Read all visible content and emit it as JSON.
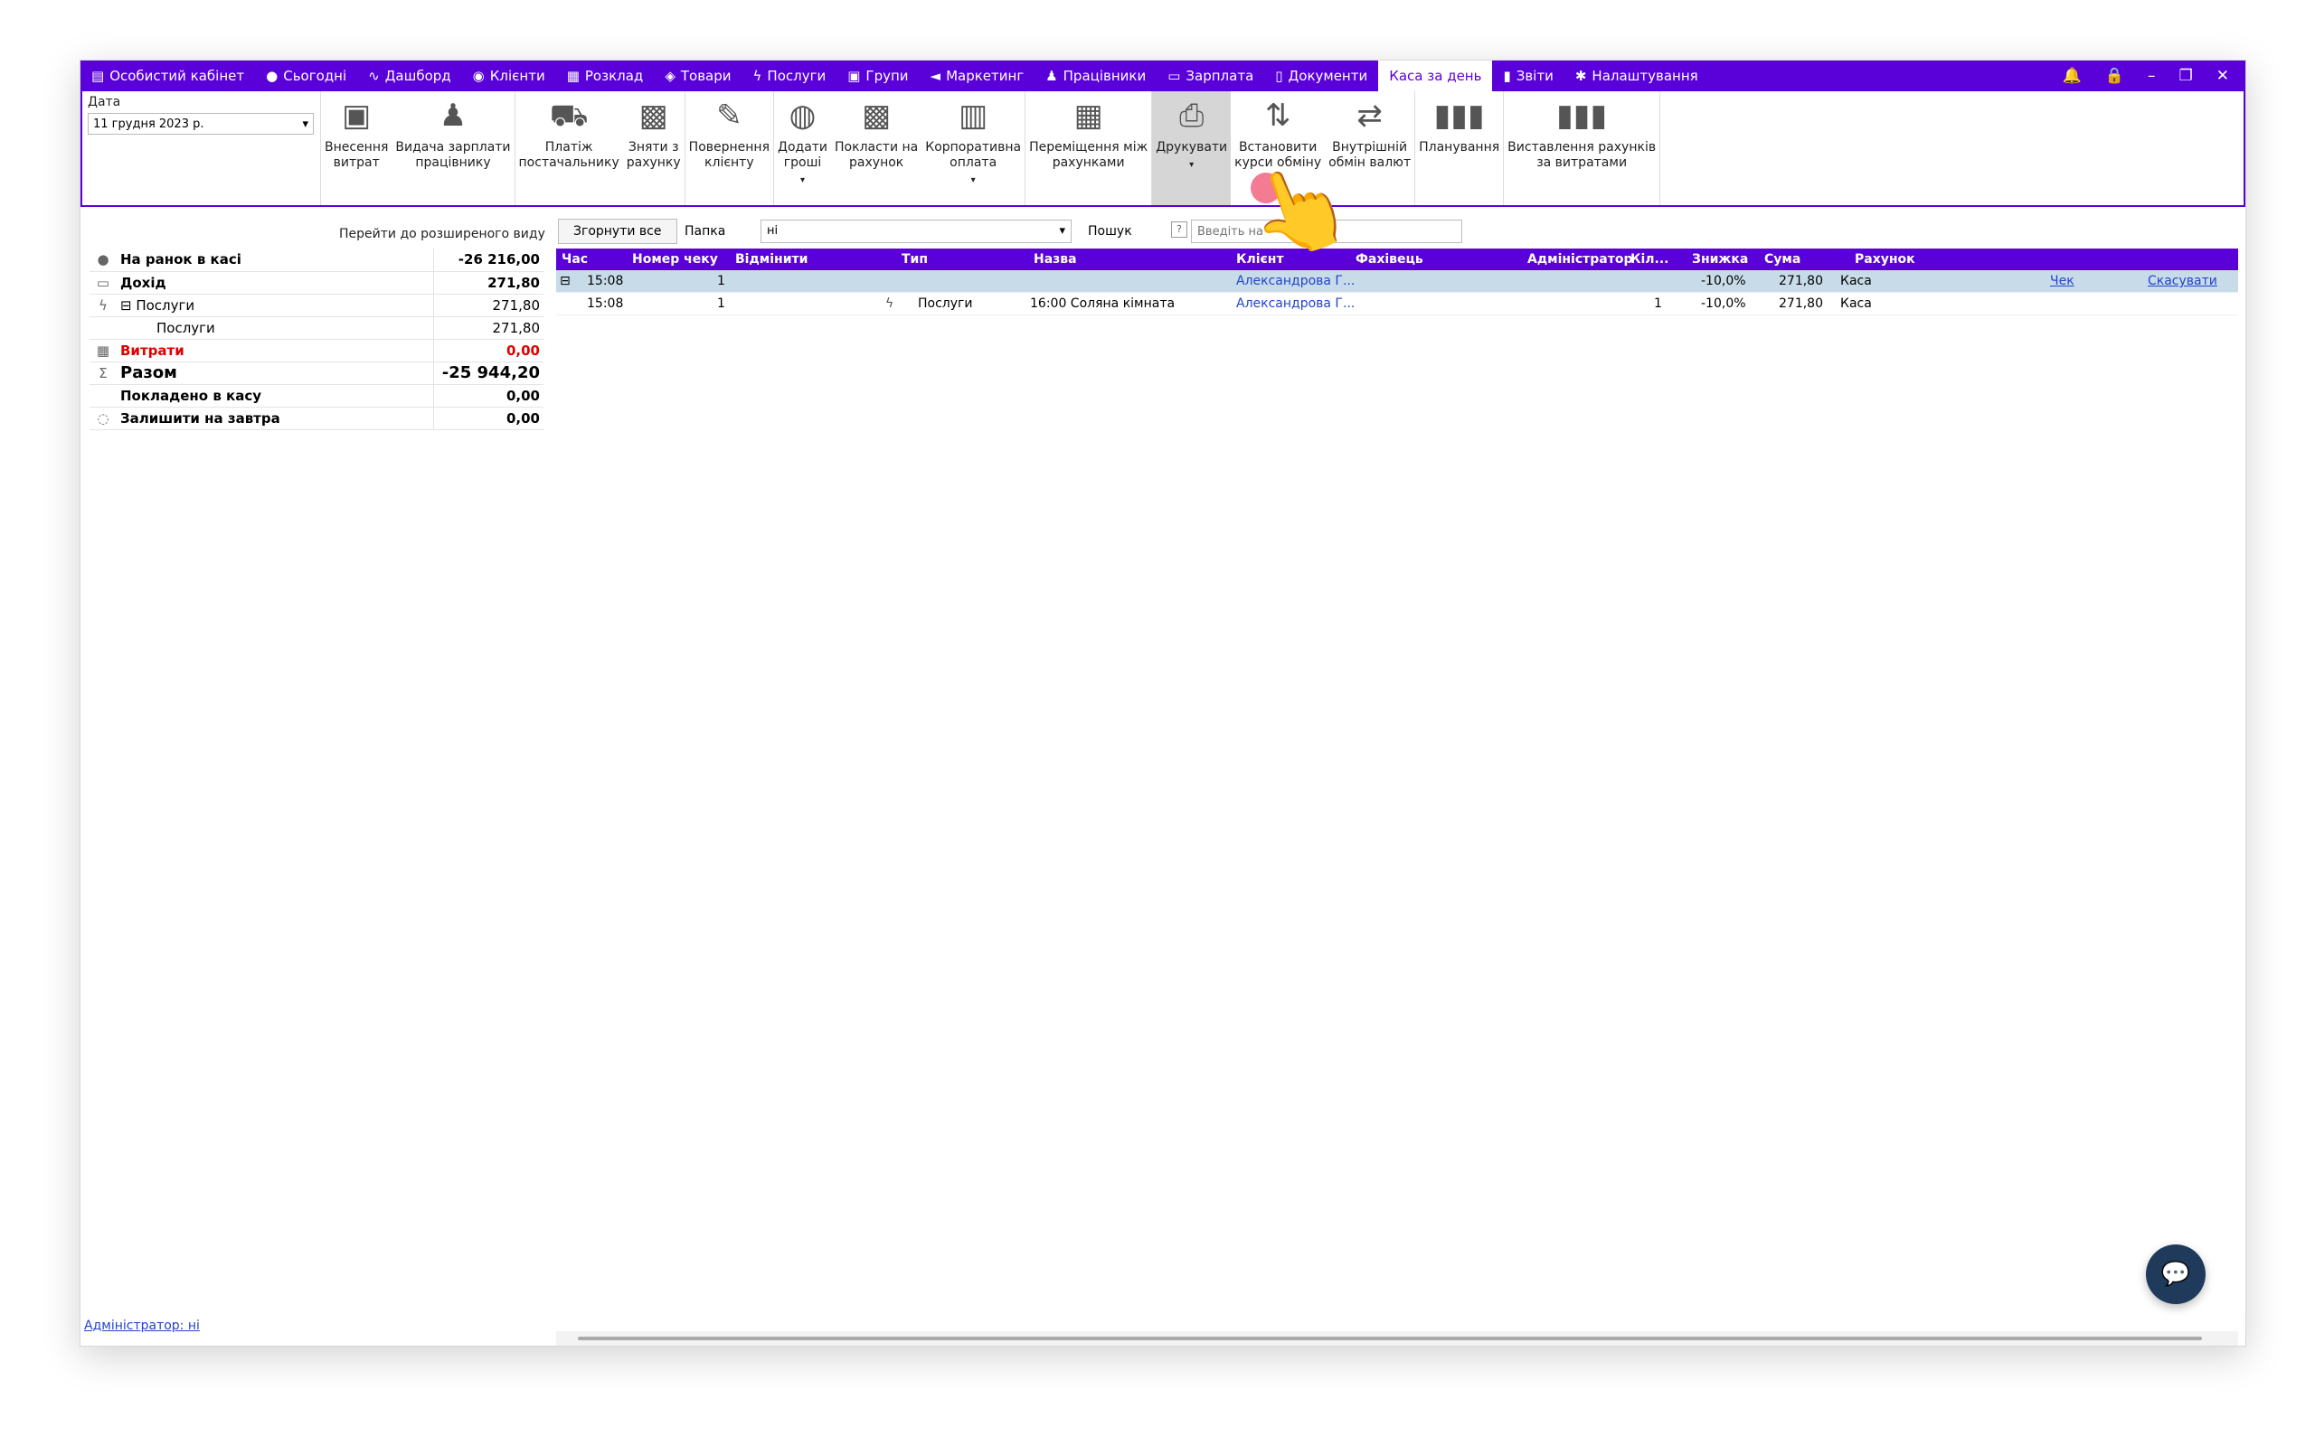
{
  "nav": {
    "items": [
      {
        "label": "Особистий кабінет",
        "icon": "cabinet-icon",
        "glyph": "▤"
      },
      {
        "label": "Сьогодні",
        "icon": "today-icon",
        "glyph": "●"
      },
      {
        "label": "Дашборд",
        "icon": "dashboard-icon",
        "glyph": "∿"
      },
      {
        "label": "Клієнти",
        "icon": "user-circle-icon",
        "glyph": "◉"
      },
      {
        "label": "Розклад",
        "icon": "calendar-icon",
        "glyph": "▦"
      },
      {
        "label": "Товари",
        "icon": "box-icon",
        "glyph": "◈"
      },
      {
        "label": "Послуги",
        "icon": "lightning-icon",
        "glyph": "ϟ"
      },
      {
        "label": "Групи",
        "icon": "groups-icon",
        "glyph": "▣"
      },
      {
        "label": "Маркетинг",
        "icon": "megaphone-icon",
        "glyph": "◄"
      },
      {
        "label": "Працівники",
        "icon": "person-icon",
        "glyph": "♟"
      },
      {
        "label": "Зарплата",
        "icon": "cash-icon",
        "glyph": "▭"
      },
      {
        "label": "Документи",
        "icon": "document-icon",
        "glyph": "▯"
      },
      {
        "label": "Каса за день",
        "icon": "",
        "glyph": ""
      },
      {
        "label": "Звіти",
        "icon": "bar-chart-icon",
        "glyph": "▮"
      },
      {
        "label": "Налаштування",
        "icon": "gear-icon",
        "glyph": "✱"
      }
    ],
    "active_index": 12,
    "window_controls": [
      "🔔",
      "🔒",
      "–",
      "❐",
      "✕"
    ]
  },
  "ribbon": {
    "date_label": "Дата",
    "date_value": "11 грудня  2023 р.",
    "groups": [
      [
        {
          "label": "Внесення\nвитрат",
          "icon": "cash-icon",
          "glyph": "▣",
          "caret": false
        },
        {
          "label": "Видача зарплати\nпрацівнику",
          "icon": "salary-icon",
          "glyph": "♟",
          "caret": false
        }
      ],
      [
        {
          "label": "Платіж\nпостачальнику",
          "icon": "truck-icon",
          "glyph": "⛟",
          "caret": false
        },
        {
          "label": "Зняти з\nрахунку",
          "icon": "safe-icon",
          "glyph": "▩",
          "caret": false
        }
      ],
      [
        {
          "label": "Повернення\nклієнту",
          "icon": "refund-icon",
          "glyph": "✎",
          "caret": false
        }
      ],
      [
        {
          "label": "Додати\nгроші",
          "icon": "coins-icon",
          "glyph": "◍",
          "caret": true
        },
        {
          "label": "Покласти на\nрахунок",
          "icon": "deposit-icon",
          "glyph": "▩",
          "caret": false
        },
        {
          "label": "Корпоративна\nоплата",
          "icon": "building-icon",
          "glyph": "▥",
          "caret": true
        }
      ],
      [
        {
          "label": "Переміщення між\nрахунками",
          "icon": "calculator-icon",
          "glyph": "▦",
          "caret": false
        }
      ],
      [
        {
          "label": "Друкувати",
          "icon": "printer-icon",
          "glyph": "⎙",
          "caret": true,
          "pressed": true
        },
        {
          "label": "Встановити\nкурси обміну",
          "icon": "exchange-rate-icon",
          "glyph": "⇅",
          "caret": false
        },
        {
          "label": "Внутрішній\nобмін валют",
          "icon": "currency-exchange-icon",
          "glyph": "⇄",
          "caret": false
        }
      ],
      [
        {
          "label": "Планування",
          "icon": "planning-chart-icon",
          "glyph": "▮▮▮",
          "caret": false
        }
      ],
      [
        {
          "label": "Виставлення рахунків\nза витратами",
          "icon": "invoice-chart-icon",
          "glyph": "▮▮▮",
          "caret": false
        }
      ]
    ]
  },
  "left": {
    "goto_link": "Перейти до розширеного виду",
    "rows": [
      {
        "icon": "coin-icon",
        "glyph": "●",
        "label": "На ранок в касі",
        "value": "-26 216,00",
        "style": "bold",
        "indent": 0
      },
      {
        "icon": "cash-icon",
        "glyph": "▭",
        "label": "Дохід",
        "value": "271,80",
        "style": "bold",
        "indent": 0
      },
      {
        "icon": "lightning-icon",
        "glyph": "ϟ",
        "label": "⊟ Послуги",
        "value": "271,80",
        "style": "",
        "indent": 0
      },
      {
        "icon": "",
        "glyph": "",
        "label": "Послуги",
        "value": "271,80",
        "style": "",
        "indent": 2
      },
      {
        "icon": "calculator-icon",
        "glyph": "▦",
        "label": "Витрати",
        "value": "0,00",
        "style": "red",
        "indent": 0
      },
      {
        "icon": "sigma-icon",
        "glyph": "Σ",
        "label": "Разом",
        "value": "-25 944,20",
        "style": "big",
        "indent": 0
      },
      {
        "icon": "",
        "glyph": "",
        "label": "Покладено в касу",
        "value": "0,00",
        "style": "bold",
        "indent": 0
      },
      {
        "icon": "leave-icon",
        "glyph": "◌",
        "label": "Залишити на завтра",
        "value": "0,00",
        "style": "bold",
        "indent": 0
      }
    ],
    "admin_link": "Адміністратор: ні"
  },
  "toolbar": {
    "collapse_label": "Згорнути все",
    "folder_label": "Папка",
    "folder_value": "ні",
    "search_label": "Пошук",
    "help_glyph": "?",
    "search_placeholder": "Введіть на"
  },
  "grid": {
    "headers": [
      "Час",
      "Номер чеку",
      "Відмінити",
      "Тип",
      "Назва",
      "Клієнт",
      "Фахівець",
      "Адміністратор",
      "Кіл...",
      "Знижка",
      "Сума",
      "Рахунок"
    ],
    "rows": [
      {
        "expander": "⊟",
        "time": "15:08",
        "receipt": "1",
        "type": "",
        "name": "",
        "client": "Александрова Г...",
        "qty": "",
        "discount": "-10,0%",
        "sum": "271,80",
        "account": "Каса",
        "check_link": "Чек",
        "cancel_link": "Скасувати",
        "selected": true
      },
      {
        "expander": "",
        "time": "15:08",
        "receipt": "1",
        "type": "Послуги",
        "name": "16:00 Соляна кімната",
        "client": "Александрова Г...",
        "qty": "1",
        "discount": "-10,0%",
        "sum": "271,80",
        "account": "Каса",
        "check_link": "",
        "cancel_link": "",
        "selected": false
      }
    ]
  },
  "colors": {
    "accent": "#5a00d8",
    "selected_row": "#c8dbe8",
    "link": "#2244cc",
    "negative": "#e00000"
  }
}
